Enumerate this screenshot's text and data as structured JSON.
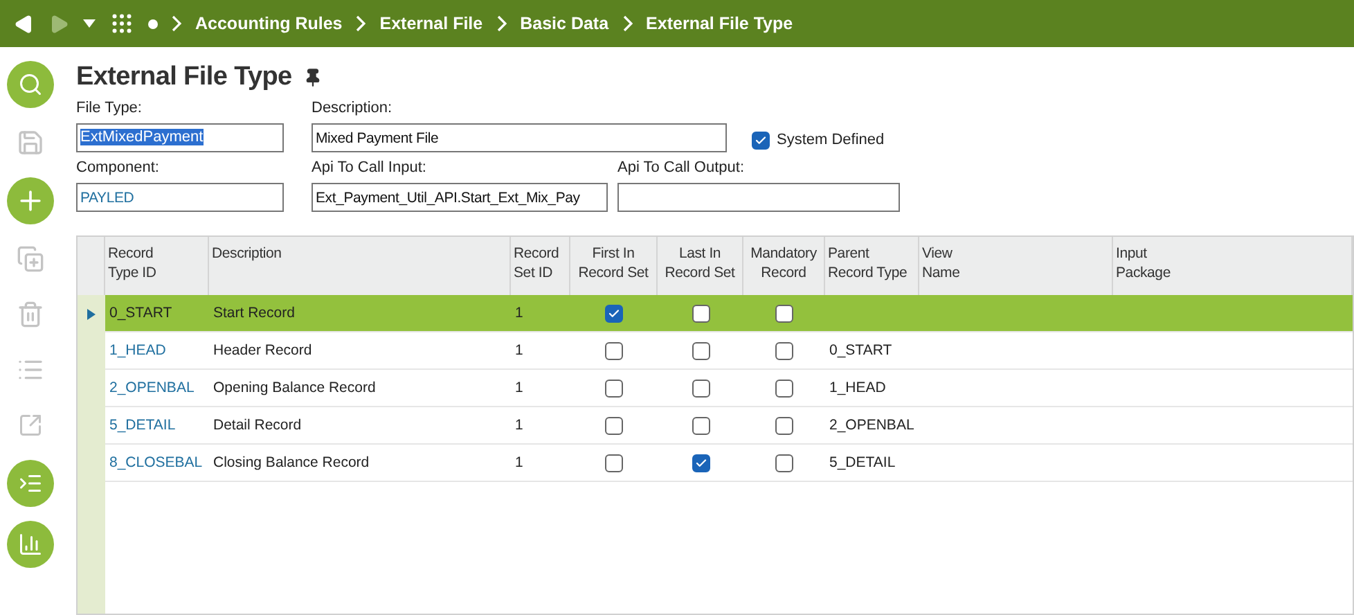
{
  "breadcrumb": [
    "Accounting Rules",
    "External File",
    "Basic Data",
    "External File Type"
  ],
  "page_title": "External File Type",
  "form": {
    "file_type": {
      "label": "File Type:",
      "value": "ExtMixedPayment",
      "text_selected": true
    },
    "description": {
      "label": "Description:",
      "value": "Mixed Payment File"
    },
    "system_defined": {
      "label": "System Defined",
      "checked": true
    },
    "component": {
      "label": "Component:",
      "value": "PAYLED"
    },
    "api_input": {
      "label": "Api To Call Input:",
      "value": "Ext_Payment_Util_API.Start_Ext_Mix_Pay"
    },
    "api_output": {
      "label": "Api To Call Output:"
    }
  },
  "table": {
    "columns": [
      [
        "Record",
        "Type ID"
      ],
      [
        "Description"
      ],
      [
        "Record",
        "Set ID"
      ],
      [
        "First In",
        "Record Set"
      ],
      [
        "Last In",
        "Record Set"
      ],
      [
        "Mandatory",
        "Record"
      ],
      [
        "Parent",
        "Record Type"
      ],
      [
        "View",
        "Name"
      ],
      [
        "Input",
        "Package"
      ]
    ],
    "rows": [
      {
        "selected": true,
        "type_id": "0_START",
        "description": "Start Record",
        "set_id": "1",
        "first": true,
        "last": false,
        "mandatory": false
      },
      {
        "selected": false,
        "type_id": "1_HEAD",
        "description": "Header Record",
        "set_id": "1",
        "first": false,
        "last": false,
        "mandatory": false,
        "parent": "0_START"
      },
      {
        "selected": false,
        "type_id": "2_OPENBAL",
        "description": "Opening Balance Record",
        "set_id": "1",
        "first": false,
        "last": false,
        "mandatory": false,
        "parent": "1_HEAD"
      },
      {
        "selected": false,
        "type_id": "5_DETAIL",
        "description": "Detail Record",
        "set_id": "1",
        "first": false,
        "last": false,
        "mandatory": false,
        "parent": "2_OPENBAL"
      },
      {
        "selected": false,
        "type_id": "8_CLOSEBAL",
        "description": "Closing Balance Record",
        "set_id": "1",
        "first": false,
        "last": true,
        "mandatory": false,
        "parent": "5_DETAIL"
      }
    ]
  }
}
